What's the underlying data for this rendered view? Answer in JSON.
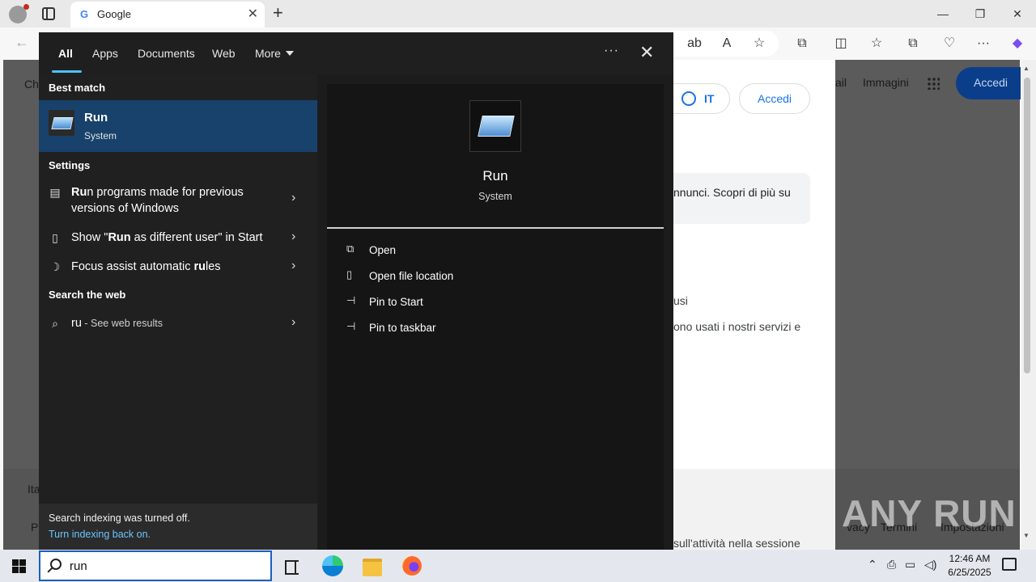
{
  "browser": {
    "tab_title": "Google",
    "tab_close": "✕",
    "new_tab": "+",
    "window_controls": [
      "—",
      "❐",
      "✕"
    ],
    "page": {
      "lang_button": "IT",
      "signin_card": "Accedi",
      "signin_nav": "Accedi",
      "nav_links": [
        "ail",
        "Immagini"
      ],
      "left_partial": "Ch",
      "consent_text": "nnunci. Scopri di più su",
      "line_usi": "usi",
      "line_services": "ono usati i nostri servizi e",
      "line_session": "sull'attività nella sessione",
      "footer_left_1": "Ita",
      "footer_left_2": "P",
      "footer_links": [
        "vacy",
        "Termini",
        "Impostazioni"
      ]
    },
    "watermark": "ANY RUN"
  },
  "flyout": {
    "tabs": [
      "All",
      "Apps",
      "Documents",
      "Web",
      "More"
    ],
    "options": "···",
    "close": "✕",
    "best_match_header": "Best match",
    "best_match": {
      "title": "Run",
      "subtitle": "System"
    },
    "settings_header": "Settings",
    "settings_items": [
      {
        "pre": "",
        "bold": "Ru",
        "post": "n programs made for previous",
        "line2": "versions of Windows"
      },
      {
        "pre": "Show \"",
        "bold": "Run",
        "post": " as different user\" in Start",
        "line2": ""
      },
      {
        "pre": "Focus assist automatic ",
        "bold": "ru",
        "post": "les",
        "line2": ""
      }
    ],
    "web_header": "Search the web",
    "web_item": {
      "query": "ru",
      "suffix": " - See web results"
    },
    "indexing_text": "Search indexing was turned off.",
    "indexing_link": "Turn indexing back on.",
    "preview": {
      "title": "Run",
      "subtitle": "System",
      "actions": [
        "Open",
        "Open file location",
        "Pin to Start",
        "Pin to taskbar"
      ]
    }
  },
  "taskbar": {
    "search_value": "run",
    "time": "12:46 AM",
    "date": "6/25/2025"
  },
  "colors": {
    "flyout_bg": "#1c1c1c",
    "best_match_bg": "#18426b",
    "accent": "#4cc2ff",
    "link": "#6cc4ff"
  }
}
